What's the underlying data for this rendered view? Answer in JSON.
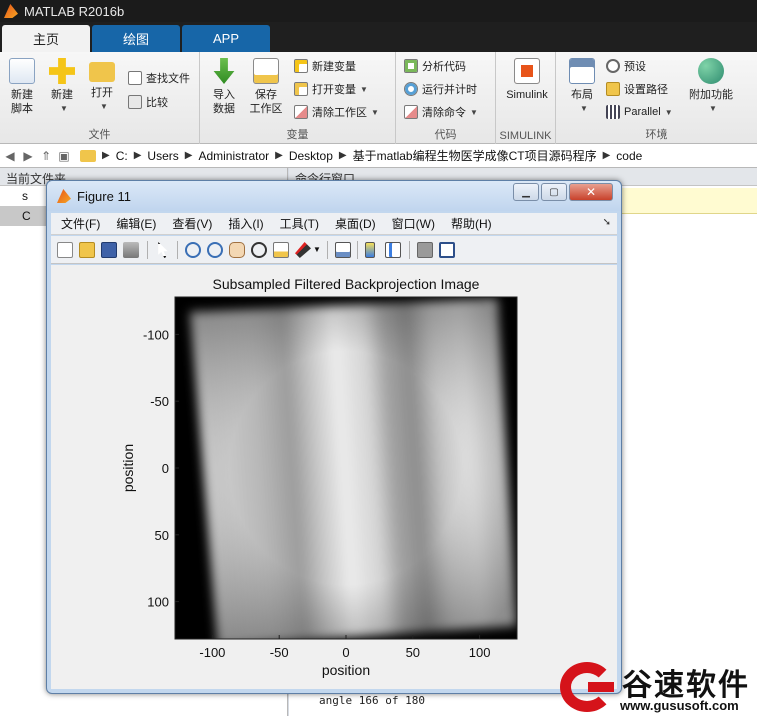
{
  "app": {
    "title": "MATLAB R2016b",
    "tabs": [
      {
        "label": "主页",
        "active": true
      },
      {
        "label": "绘图",
        "active": false
      },
      {
        "label": "APP",
        "active": false
      }
    ]
  },
  "ribbon": {
    "file_group": {
      "label": "文件",
      "new_script": [
        "新建",
        "脚本"
      ],
      "new": "新建",
      "open": "打开",
      "find_files": "查找文件",
      "compare": "比较"
    },
    "variable_group": {
      "label": "变量",
      "import_data": [
        "导入",
        "数据"
      ],
      "save_workspace": [
        "保存",
        "工作区"
      ],
      "new_variable": "新建变量",
      "open_variable": "打开变量",
      "clear_workspace": "清除工作区"
    },
    "code_group": {
      "label": "代码",
      "analyze_code": "分析代码",
      "run_and_time": "运行并计时",
      "clear_commands": "清除命令"
    },
    "simulink_group": {
      "label": "SIMULINK",
      "simulink": "Simulink"
    },
    "environment_group": {
      "label": "环境",
      "layout": "布局",
      "preferences": "预设",
      "set_path": "设置路径",
      "parallel": "Parallel",
      "add_ons": "附加功能"
    }
  },
  "address_bar": {
    "path": [
      "C:",
      "Users",
      "Administrator",
      "Desktop",
      "基于matlab编程生物医学成像CT项目源码程序",
      "code"
    ]
  },
  "file_panel": {
    "title": "当前文件夹",
    "rows": [
      "s",
      "C"
    ]
  },
  "command_panel": {
    "title": "命令行窗口",
    "last_line": "angle 166 of 180"
  },
  "figure": {
    "title": "Figure 11",
    "menu": [
      "文件(F)",
      "编辑(E)",
      "查看(V)",
      "插入(I)",
      "工具(T)",
      "桌面(D)",
      "窗口(W)",
      "帮助(H)"
    ]
  },
  "chart_data": {
    "type": "heatmap",
    "title": "Subsampled Filtered Backprojection Image",
    "xlabel": "position",
    "ylabel": "position",
    "x_ticks": [
      -100,
      -50,
      0,
      50,
      100
    ],
    "y_ticks": [
      -100,
      -50,
      0,
      50,
      100
    ],
    "xlim": [
      -128,
      128
    ],
    "ylim": [
      -128,
      128
    ],
    "y_axis_reversed": true,
    "colormap": "gray"
  },
  "watermark": {
    "name": "谷速软件",
    "url": "www.gususoft.com"
  },
  "colors": {
    "tab_blue": "#1766a8",
    "figure_frame": "#c2d7ee",
    "watermark_red": "#d5131a"
  }
}
